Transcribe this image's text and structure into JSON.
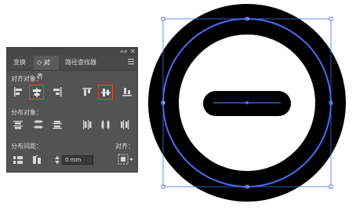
{
  "panel": {
    "collapse_glyph": "««",
    "close_glyph": "✕",
    "tabs": [
      {
        "label": "变换"
      },
      {
        "label": "◇ 对齐"
      },
      {
        "label": "路径查找器"
      }
    ],
    "align_objects_label": "对齐对象：",
    "distribute_objects_label": "分布对象：",
    "distribute_spacing_label": "分布间距：",
    "align_to_label": "对齐：",
    "spacing_value": "0 mm"
  },
  "colors": {
    "panel_bg": "#535353",
    "highlight": "#e8443a",
    "selection": "#4a6cf0",
    "artwork": "#000000"
  }
}
